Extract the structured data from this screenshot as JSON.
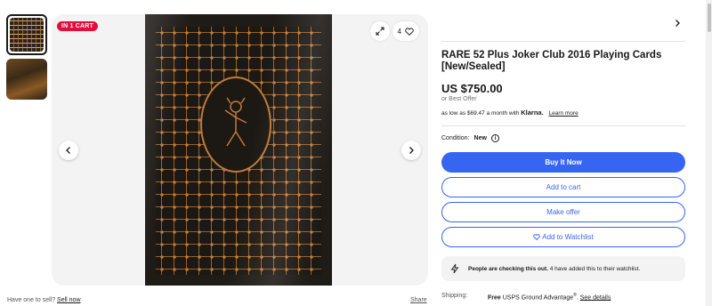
{
  "gallery": {
    "cart_badge": "IN 1 CART",
    "watch_count": "4"
  },
  "listing": {
    "title": "RARE 52 Plus Joker Club 2016 Playing Cards [New/Sealed]",
    "price": "US $750.00",
    "best_offer": "or Best Offer",
    "klarna_prefix": "as low as $69.47 a month with",
    "klarna_brand": "Klarna.",
    "learn_more": "Learn more",
    "condition_label": "Condition:",
    "condition_value": "New"
  },
  "actions": {
    "buy_now": "Buy It Now",
    "add_to_cart": "Add to cart",
    "make_offer": "Make offer",
    "add_to_watchlist": "Add to Watchlist"
  },
  "activity": {
    "headline": "People are checking this out.",
    "detail": "4 have added this to their watchlist."
  },
  "shipping": {
    "label": "Shipping:",
    "free": "Free",
    "service": "USPS Ground Advantage",
    "reg": "®",
    "see_details": "See details"
  },
  "footer": {
    "have_one": "Have one to sell?",
    "sell_now": "Sell now",
    "share": "Share"
  },
  "colors": {
    "primary": "#3665f3",
    "cart_badge": "#e0103a"
  }
}
